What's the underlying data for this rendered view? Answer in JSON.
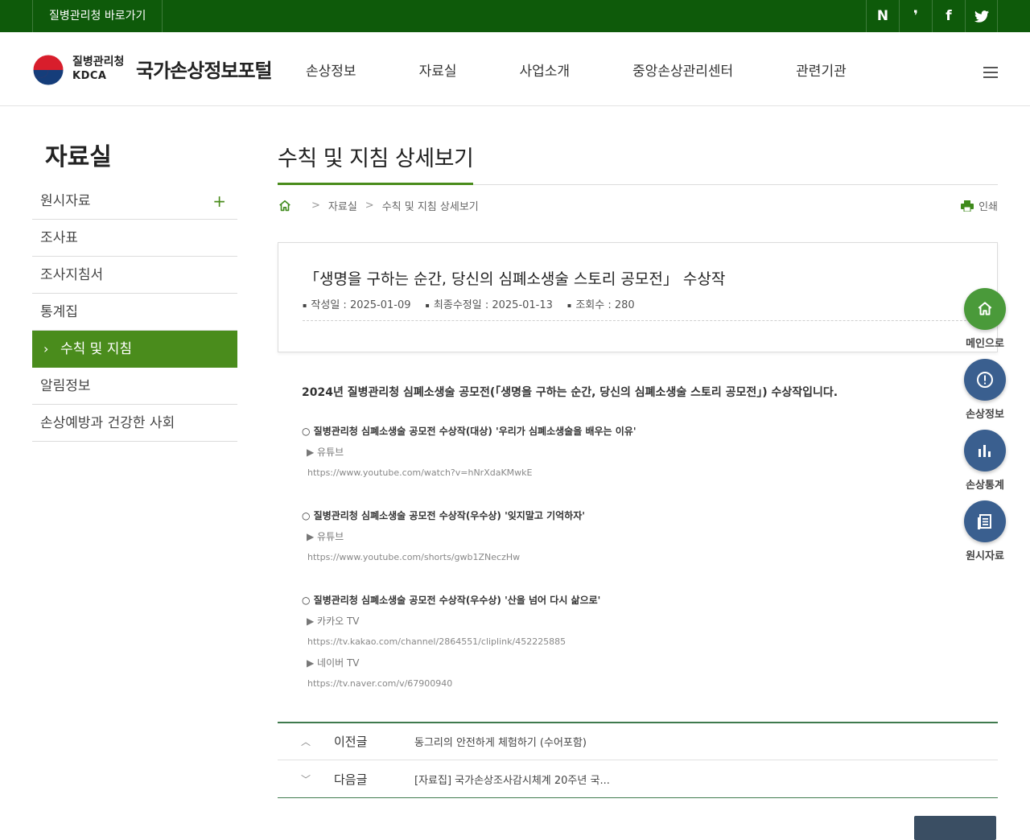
{
  "topbar": {
    "goto_label": "질병관리청 바로가기",
    "social": [
      {
        "icon": "naver-blog-icon",
        "glyph": "N"
      },
      {
        "icon": "naver-post-icon",
        "glyph": "❜"
      },
      {
        "icon": "facebook-icon",
        "glyph": "f"
      },
      {
        "icon": "twitter-icon",
        "glyph": "🐦"
      }
    ]
  },
  "header": {
    "org_name": "질병관리청",
    "org_en": "KDCA",
    "site_title": "국가손상정보포털",
    "menu": [
      "손상정보",
      "자료실",
      "사업소개",
      "중앙손상관리센터",
      "관련기관"
    ]
  },
  "sidebar": {
    "title": "자료실",
    "items": [
      {
        "label": "원시자료",
        "plus": "+"
      },
      {
        "label": "조사표"
      },
      {
        "label": "조사지침서"
      },
      {
        "label": "통계집"
      },
      {
        "label": "수칙 및 지침",
        "active": true
      },
      {
        "label": "알림정보"
      },
      {
        "label": "손상예방과 건강한 사회"
      }
    ]
  },
  "page": {
    "title": "수칙 및 지침 상세보기",
    "breadcrumb": [
      "자료실",
      "수칙 및 지침 상세보기"
    ],
    "print_label": "인쇄"
  },
  "post": {
    "title": "「생명을 구하는 순간, 당신의 심폐소생술 스토리 공모전」 수상작",
    "meta": {
      "created": "작성일 : 2025-01-09",
      "modified": "최종수정일 : 2025-01-13",
      "views": "조회수 : 280"
    },
    "lead": "2024년 질병관리청 심폐소생술 공모전(「생명을 구하는 순간, 당신의 심폐소생술 스토리 공모전」) 수상작입니다.",
    "sections": [
      {
        "heading": "○ 질병관리청 심폐소생술 공모전 수상작(대상) '우리가 심폐소생술을 배우는 이유'",
        "links": [
          {
            "label": "▶ 유튜브",
            "url": "https://www.youtube.com/watch?v=hNrXdaKMwkE"
          }
        ]
      },
      {
        "heading": "○ 질병관리청 심폐소생술 공모전 수상작(우수상) '잊지말고 기억하자'",
        "links": [
          {
            "label": "▶ 유튜브",
            "url": "https://www.youtube.com/shorts/gwb1ZNeczHw"
          }
        ]
      },
      {
        "heading": "○ 질병관리청 심폐소생술 공모전 수상작(우수상) '산을 넘어 다시 삶으로'",
        "links": [
          {
            "label": "▶ 카카오 TV",
            "url": "https://tv.kakao.com/channel/2864551/cliplink/452225885"
          },
          {
            "label": "▶ 네이버 TV",
            "url": "https://tv.naver.com/v/67900940"
          }
        ]
      }
    ]
  },
  "post_nav": {
    "prev_label": "이전글",
    "prev_title": "동그리의 안전하게 체험하기 (수어포함)",
    "next_label": "다음글",
    "next_title": "[자료집] 국가손상조사감시체계 20주년 국..."
  },
  "quick_menu": [
    {
      "label": "메인으로",
      "icon": "home-icon",
      "color": "#4a9a3a"
    },
    {
      "label": "손상정보",
      "icon": "alert-circle-icon",
      "color": "#3a5f8f"
    },
    {
      "label": "손상통계",
      "icon": "bar-chart-icon",
      "color": "#3a5f8f"
    },
    {
      "label": "원시자료",
      "icon": "document-icon",
      "color": "#3a5f8f"
    }
  ]
}
